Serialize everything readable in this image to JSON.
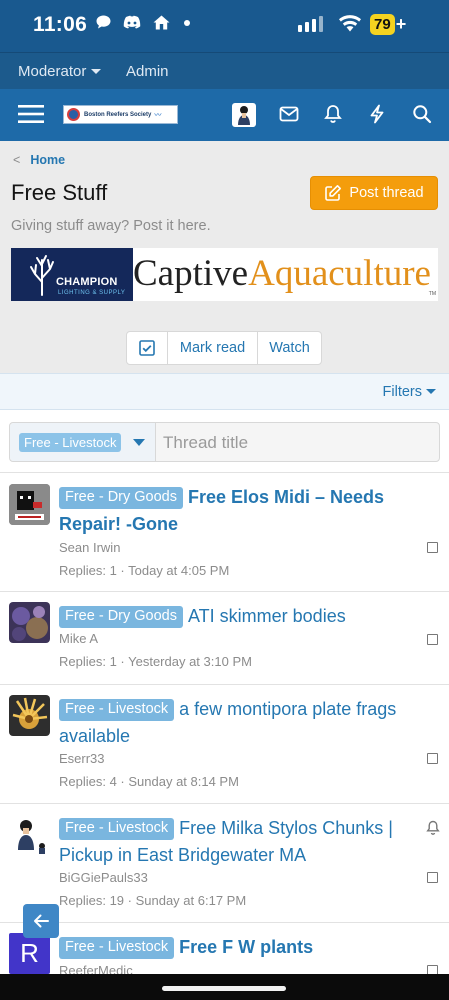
{
  "status_bar": {
    "time": "11:06",
    "battery": "79",
    "icons": [
      "message-icon",
      "discord-icon",
      "home-icon",
      "dot-icon",
      "signal-icon",
      "wifi-icon",
      "battery-icon"
    ]
  },
  "staff_bar": {
    "moderator_label": "Moderator",
    "admin_label": "Admin"
  },
  "header": {
    "logo_text": "Boston Reefers Society",
    "icons": [
      "menu-icon",
      "avatar",
      "inbox-icon",
      "bell-icon",
      "bolt-icon",
      "search-icon"
    ]
  },
  "breadcrumb": {
    "home_label": "Home"
  },
  "page": {
    "title": "Free Stuff",
    "description": "Giving stuff away? Post it here.",
    "post_button_label": "Post thread",
    "accent_color": "#f49d0c"
  },
  "banner": {
    "champion_name": "CHAMPION",
    "champion_sub": "LIGHTING & SUPPLY",
    "captive": "Captive",
    "aquaculture": "Aquaculture",
    "tm": "TM"
  },
  "actions": {
    "mark_read_label": "Mark read",
    "watch_label": "Watch"
  },
  "filter_bar": {
    "filters_label": "Filters",
    "prefix_selected": "Free - Livestock",
    "title_placeholder": "Thread title"
  },
  "threads": [
    {
      "prefix": "Free - Dry Goods",
      "title": "Free Elos Midi – Needs Repair! -Gone",
      "author": "Sean Irwin",
      "meta": "Replies: 1 · Today at 4:05 PM",
      "unread": true
    },
    {
      "prefix": "Free - Dry Goods",
      "title": "ATI skimmer bodies",
      "author": "Mike A",
      "meta": "Replies: 1 · Yesterday at 3:10 PM",
      "unread": false
    },
    {
      "prefix": "Free - Livestock",
      "title": "a few montipora plate frags available",
      "author": "Eserr33",
      "meta": "Replies: 4 · Sunday at 8:14 PM",
      "unread": false
    },
    {
      "prefix": "Free - Livestock",
      "title": "Free Milka Stylos Chunks | Pickup in East Bridgewater MA",
      "author": "BiGGiePauls33",
      "meta": "Replies: 19 · Sunday at 6:17 PM",
      "unread": false
    },
    {
      "prefix": "Free - Livestock",
      "title": "Free F W plants",
      "author": "ReeferMedic",
      "avatar_letter": "R",
      "unread": true
    }
  ]
}
